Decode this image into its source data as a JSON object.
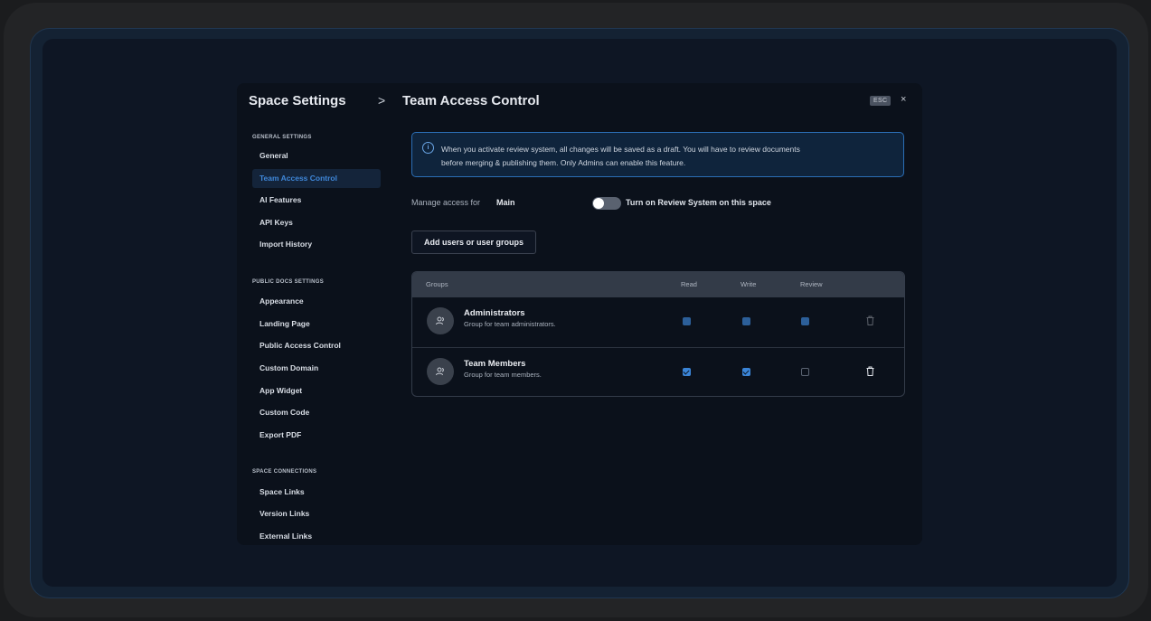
{
  "header": {
    "title": "Space Settings",
    "separator": ">",
    "page_title": "Team Access Control",
    "esc_label": "ESC",
    "close_label": "×"
  },
  "sidebar": {
    "general_label": "GENERAL SETTINGS",
    "general_items": [
      "General",
      "Team Access Control",
      "AI Features",
      "API Keys",
      "Import History"
    ],
    "public_label": "PUBLIC DOCS SETTINGS",
    "public_items": [
      "Appearance",
      "Landing Page",
      "Public Access Control",
      "Custom Domain",
      "App Widget",
      "Custom Code",
      "Export PDF"
    ],
    "connections_label": "SPACE CONNECTIONS",
    "connections_items": [
      "Space Links",
      "Version Links",
      "External Links"
    ],
    "active_item": "Team Access Control"
  },
  "info": {
    "icon": "info-icon",
    "text_line1": "When you activate review system, all changes will be saved as a draft. You will have to review documents",
    "text_line2": "before merging & publishing them. Only Admins can enable this feature."
  },
  "manage": {
    "label": "Manage access for",
    "value": "Main",
    "toggle_label": "Turn on Review System on this space",
    "toggle_on": false
  },
  "add_button": "Add users or user groups",
  "table": {
    "columns": [
      "Groups",
      "Read",
      "Write",
      "Review"
    ],
    "rows": [
      {
        "name": "Administrators",
        "description": "Group for team administrators.",
        "read": true,
        "write": true,
        "review": true,
        "locked": true
      },
      {
        "name": "Team Members",
        "description": "Group for team members.",
        "read": true,
        "write": true,
        "review": false,
        "locked": false
      }
    ]
  },
  "colors": {
    "accent": "#3a84d6",
    "background": "#0b111b",
    "info_border": "#2b6eb5"
  }
}
